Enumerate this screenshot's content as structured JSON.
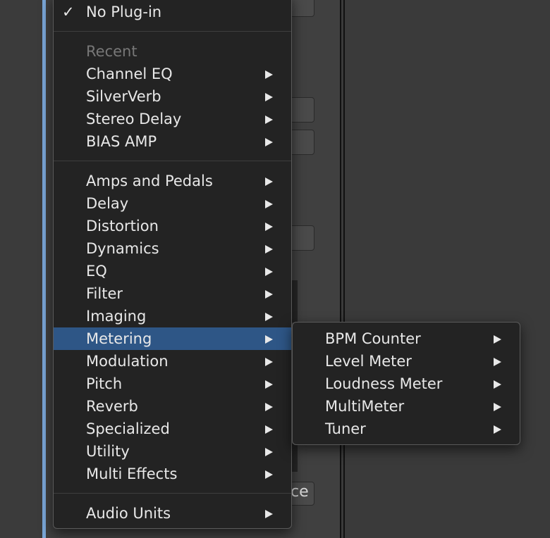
{
  "background": {
    "button_text": "ce"
  },
  "menu": {
    "no_plugin": {
      "label": "No Plug-in",
      "checked": true,
      "check_glyph": "✓"
    },
    "recent_header": "Recent",
    "recent": [
      {
        "label": "Channel EQ"
      },
      {
        "label": "SilverVerb"
      },
      {
        "label": "Stereo Delay"
      },
      {
        "label": "BIAS AMP"
      }
    ],
    "categories": [
      {
        "label": "Amps and Pedals"
      },
      {
        "label": "Delay"
      },
      {
        "label": "Distortion"
      },
      {
        "label": "Dynamics"
      },
      {
        "label": "EQ"
      },
      {
        "label": "Filter"
      },
      {
        "label": "Imaging"
      },
      {
        "label": "Metering",
        "selected": true
      },
      {
        "label": "Modulation"
      },
      {
        "label": "Pitch"
      },
      {
        "label": "Reverb"
      },
      {
        "label": "Specialized"
      },
      {
        "label": "Utility"
      },
      {
        "label": "Multi Effects"
      }
    ],
    "audio_units": {
      "label": "Audio Units"
    }
  },
  "submenu": {
    "items": [
      {
        "label": "BPM Counter"
      },
      {
        "label": "Level Meter"
      },
      {
        "label": "Loudness Meter"
      },
      {
        "label": "MultiMeter"
      },
      {
        "label": "Tuner"
      }
    ]
  },
  "colors": {
    "menu_bg": "#232323",
    "selected_bg": "#2e5686",
    "text": "#e8e8e8",
    "header_text": "#777777"
  }
}
